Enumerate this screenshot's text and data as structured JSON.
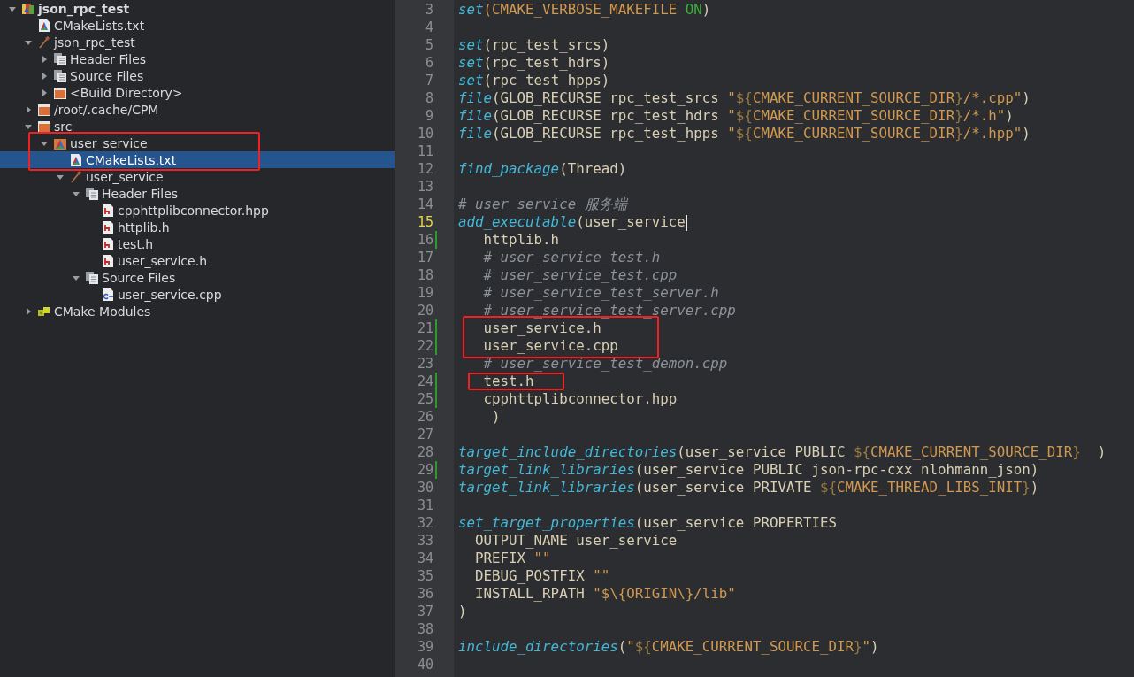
{
  "tree": [
    {
      "label": "json_rpc_test",
      "kind": "project",
      "expanded": true,
      "selected": false,
      "annotated": false,
      "children": [
        {
          "label": "CMakeLists.txt",
          "kind": "cmake-file",
          "selected": false,
          "annotated": false
        },
        {
          "label": "json_rpc_test",
          "kind": "hammer",
          "expanded": true,
          "selected": false,
          "annotated": false,
          "children": [
            {
              "label": "Header Files",
              "kind": "group",
              "expanded": false,
              "selected": false,
              "annotated": false
            },
            {
              "label": "Source Files",
              "kind": "group",
              "expanded": false,
              "selected": false,
              "annotated": false
            },
            {
              "label": "<Build Directory>",
              "kind": "folder",
              "expanded": false,
              "selected": false,
              "annotated": false
            }
          ]
        },
        {
          "label": "/root/.cache/CPM",
          "kind": "folder",
          "expanded": false,
          "selected": false,
          "annotated": false
        },
        {
          "label": "src",
          "kind": "folder",
          "expanded": true,
          "selected": false,
          "annotated": false,
          "children": [
            {
              "label": "user_service",
              "kind": "cmake-folder",
              "expanded": true,
              "selected": false,
              "annotated": true,
              "children": [
                {
                  "label": "CMakeLists.txt",
                  "kind": "cmake-file",
                  "selected": true,
                  "annotated": true
                },
                {
                  "label": "user_service",
                  "kind": "hammer",
                  "expanded": true,
                  "selected": false,
                  "annotated": false,
                  "children": [
                    {
                      "label": "Header Files",
                      "kind": "group",
                      "expanded": true,
                      "selected": false,
                      "annotated": false,
                      "children": [
                        {
                          "label": "cpphttplibconnector.hpp",
                          "kind": "header",
                          "selected": false,
                          "annotated": false
                        },
                        {
                          "label": "httplib.h",
                          "kind": "header",
                          "selected": false,
                          "annotated": false
                        },
                        {
                          "label": "test.h",
                          "kind": "header",
                          "selected": false,
                          "annotated": false
                        },
                        {
                          "label": "user_service.h",
                          "kind": "header",
                          "selected": false,
                          "annotated": false
                        }
                      ]
                    },
                    {
                      "label": "Source Files",
                      "kind": "group",
                      "expanded": true,
                      "selected": false,
                      "annotated": false,
                      "children": [
                        {
                          "label": "user_service.cpp",
                          "kind": "cpp",
                          "selected": false,
                          "annotated": false
                        }
                      ]
                    }
                  ]
                }
              ]
            }
          ]
        },
        {
          "label": "CMake Modules",
          "kind": "modules",
          "expanded": false,
          "selected": false,
          "annotated": false
        }
      ]
    }
  ],
  "editor": {
    "lines": [
      {
        "number": "3",
        "current": false,
        "changed": false,
        "annotated": false,
        "segments": [
          {
            "kind": "fn",
            "text": "set"
          },
          {
            "kind": "var",
            "text": "(CMAKE_VERBOSE_MAKEFILE "
          },
          {
            "kind": "kw",
            "text": "ON"
          },
          {
            "kind": "plain",
            "text": ")"
          }
        ]
      },
      {
        "number": "4",
        "current": false,
        "changed": false,
        "annotated": false
      },
      {
        "number": "5",
        "current": false,
        "changed": false,
        "annotated": false,
        "segments": [
          {
            "kind": "fn",
            "text": "set"
          },
          {
            "kind": "plain",
            "text": "(rpc_test_srcs)"
          }
        ]
      },
      {
        "number": "6",
        "current": false,
        "changed": false,
        "annotated": false,
        "segments": [
          {
            "kind": "fn",
            "text": "set"
          },
          {
            "kind": "plain",
            "text": "(rpc_test_hdrs)"
          }
        ]
      },
      {
        "number": "7",
        "current": false,
        "changed": false,
        "annotated": false,
        "segments": [
          {
            "kind": "fn",
            "text": "set"
          },
          {
            "kind": "plain",
            "text": "(rpc_test_hpps)"
          }
        ]
      },
      {
        "number": "8",
        "current": false,
        "changed": false,
        "annotated": false,
        "segments": [
          {
            "kind": "fn",
            "text": "file"
          },
          {
            "kind": "plain",
            "text": "(GLOB_RECURSE rpc_test_srcs "
          },
          {
            "kind": "var",
            "text": "\""
          },
          {
            "kind": "brace",
            "text": "${"
          },
          {
            "kind": "var",
            "text": "CMAKE_CURRENT_SOURCE_DIR"
          },
          {
            "kind": "brace",
            "text": "}"
          },
          {
            "kind": "var",
            "text": "/*.cpp\""
          },
          {
            "kind": "plain",
            "text": ")"
          }
        ]
      },
      {
        "number": "9",
        "current": false,
        "changed": false,
        "annotated": false,
        "segments": [
          {
            "kind": "fn",
            "text": "file"
          },
          {
            "kind": "plain",
            "text": "(GLOB_RECURSE rpc_test_hdrs "
          },
          {
            "kind": "var",
            "text": "\""
          },
          {
            "kind": "brace",
            "text": "${"
          },
          {
            "kind": "var",
            "text": "CMAKE_CURRENT_SOURCE_DIR"
          },
          {
            "kind": "brace",
            "text": "}"
          },
          {
            "kind": "var",
            "text": "/*.h\""
          },
          {
            "kind": "plain",
            "text": ")"
          }
        ]
      },
      {
        "number": "10",
        "current": false,
        "changed": false,
        "annotated": false,
        "segments": [
          {
            "kind": "fn",
            "text": "file"
          },
          {
            "kind": "plain",
            "text": "(GLOB_RECURSE rpc_test_hpps "
          },
          {
            "kind": "var",
            "text": "\""
          },
          {
            "kind": "brace",
            "text": "${"
          },
          {
            "kind": "var",
            "text": "CMAKE_CURRENT_SOURCE_DIR"
          },
          {
            "kind": "brace",
            "text": "}"
          },
          {
            "kind": "var",
            "text": "/*.hpp\""
          },
          {
            "kind": "plain",
            "text": ")"
          }
        ]
      },
      {
        "number": "11",
        "current": false,
        "changed": false,
        "annotated": false
      },
      {
        "number": "12",
        "current": false,
        "changed": false,
        "annotated": false,
        "segments": [
          {
            "kind": "fn",
            "text": "find_package"
          },
          {
            "kind": "plain",
            "text": "(Thread)"
          }
        ]
      },
      {
        "number": "13",
        "current": false,
        "changed": false,
        "annotated": false
      },
      {
        "number": "14",
        "current": false,
        "changed": false,
        "annotated": false,
        "segments": [
          {
            "kind": "comment",
            "text": "# user_service 服务端"
          }
        ]
      },
      {
        "number": "15",
        "current": true,
        "changed": false,
        "annotated": false,
        "segments": [
          {
            "kind": "fn",
            "text": "add_executable"
          },
          {
            "kind": "plain",
            "text": "(user_service"
          }
        ]
      },
      {
        "number": "16",
        "current": false,
        "changed": true,
        "annotated": false,
        "segments": [
          {
            "kind": "plain",
            "text": "   httplib.h"
          }
        ]
      },
      {
        "number": "17",
        "current": false,
        "changed": false,
        "annotated": false,
        "segments": [
          {
            "kind": "comment",
            "text": "   # user_service_test.h"
          }
        ]
      },
      {
        "number": "18",
        "current": false,
        "changed": false,
        "annotated": false,
        "segments": [
          {
            "kind": "comment",
            "text": "   # user_service_test.cpp"
          }
        ]
      },
      {
        "number": "19",
        "current": false,
        "changed": false,
        "annotated": false,
        "segments": [
          {
            "kind": "comment",
            "text": "   # user_service_test_server.h"
          }
        ]
      },
      {
        "number": "20",
        "current": false,
        "changed": false,
        "annotated": false,
        "segments": [
          {
            "kind": "comment",
            "text": "   # user_service_test_server.cpp"
          }
        ]
      },
      {
        "number": "21",
        "current": false,
        "changed": true,
        "annotated": true,
        "segments": [
          {
            "kind": "plain",
            "text": "   user_service.h"
          }
        ]
      },
      {
        "number": "22",
        "current": false,
        "changed": true,
        "annotated": true,
        "segments": [
          {
            "kind": "plain",
            "text": "   user_service.cpp"
          }
        ]
      },
      {
        "number": "23",
        "current": false,
        "changed": false,
        "annotated": false,
        "segments": [
          {
            "kind": "comment",
            "text": "   # user_service_test_demon.cpp"
          }
        ]
      },
      {
        "number": "24",
        "current": false,
        "changed": true,
        "annotated": true,
        "segments": [
          {
            "kind": "plain",
            "text": "   test.h"
          }
        ]
      },
      {
        "number": "25",
        "current": false,
        "changed": true,
        "annotated": false,
        "segments": [
          {
            "kind": "plain",
            "text": "   cpphttplibconnector.hpp"
          }
        ]
      },
      {
        "number": "26",
        "current": false,
        "changed": false,
        "annotated": false,
        "segments": [
          {
            "kind": "plain",
            "text": "    )"
          }
        ]
      },
      {
        "number": "27",
        "current": false,
        "changed": false,
        "annotated": false
      },
      {
        "number": "28",
        "current": false,
        "changed": false,
        "annotated": false,
        "segments": [
          {
            "kind": "fn",
            "text": "target_include_directories"
          },
          {
            "kind": "plain",
            "text": "(user_service PUBLIC "
          },
          {
            "kind": "brace",
            "text": "${"
          },
          {
            "kind": "var",
            "text": "CMAKE_CURRENT_SOURCE_DIR"
          },
          {
            "kind": "brace",
            "text": "}"
          },
          {
            "kind": "plain",
            "text": "  )"
          }
        ]
      },
      {
        "number": "29",
        "current": false,
        "changed": true,
        "annotated": false,
        "segments": [
          {
            "kind": "fn",
            "text": "target_link_libraries"
          },
          {
            "kind": "plain",
            "text": "(user_service PUBLIC json-rpc-cxx nlohmann_json)"
          }
        ]
      },
      {
        "number": "30",
        "current": false,
        "changed": false,
        "annotated": false,
        "segments": [
          {
            "kind": "fn",
            "text": "target_link_libraries"
          },
          {
            "kind": "plain",
            "text": "(user_service PRIVATE "
          },
          {
            "kind": "brace",
            "text": "${"
          },
          {
            "kind": "var",
            "text": "CMAKE_THREAD_LIBS_INIT"
          },
          {
            "kind": "brace",
            "text": "}"
          },
          {
            "kind": "plain",
            "text": ")"
          }
        ]
      },
      {
        "number": "31",
        "current": false,
        "changed": false,
        "annotated": false
      },
      {
        "number": "32",
        "current": false,
        "changed": false,
        "annotated": false,
        "segments": [
          {
            "kind": "fn",
            "text": "set_target_properties"
          },
          {
            "kind": "plain",
            "text": "(user_service PROPERTIES"
          }
        ]
      },
      {
        "number": "33",
        "current": false,
        "changed": false,
        "annotated": false,
        "segments": [
          {
            "kind": "plain",
            "text": "  OUTPUT_NAME user_service"
          }
        ]
      },
      {
        "number": "34",
        "current": false,
        "changed": false,
        "annotated": false,
        "segments": [
          {
            "kind": "plain",
            "text": "  PREFIX "
          },
          {
            "kind": "var",
            "text": "\"\""
          }
        ]
      },
      {
        "number": "35",
        "current": false,
        "changed": false,
        "annotated": false,
        "segments": [
          {
            "kind": "plain",
            "text": "  DEBUG_POSTFIX "
          },
          {
            "kind": "var",
            "text": "\"\""
          }
        ]
      },
      {
        "number": "36",
        "current": false,
        "changed": false,
        "annotated": false,
        "segments": [
          {
            "kind": "plain",
            "text": "  INSTALL_RPATH "
          },
          {
            "kind": "var",
            "text": "\"$\\{ORIGIN\\}/lib\""
          }
        ]
      },
      {
        "number": "37",
        "current": false,
        "changed": false,
        "annotated": false,
        "segments": [
          {
            "kind": "plain",
            "text": ")"
          }
        ]
      },
      {
        "number": "38",
        "current": false,
        "changed": false,
        "annotated": false
      },
      {
        "number": "39",
        "current": false,
        "changed": false,
        "annotated": false,
        "segments": [
          {
            "kind": "fn",
            "text": "include_directories"
          },
          {
            "kind": "plain",
            "text": "("
          },
          {
            "kind": "var",
            "text": "\""
          },
          {
            "kind": "brace",
            "text": "${"
          },
          {
            "kind": "var",
            "text": "CMAKE_CURRENT_SOURCE_DIR"
          },
          {
            "kind": "brace",
            "text": "}"
          },
          {
            "kind": "var",
            "text": "\""
          },
          {
            "kind": "plain",
            "text": ")"
          }
        ]
      },
      {
        "number": "40",
        "current": false,
        "changed": false,
        "annotated": false
      }
    ]
  }
}
